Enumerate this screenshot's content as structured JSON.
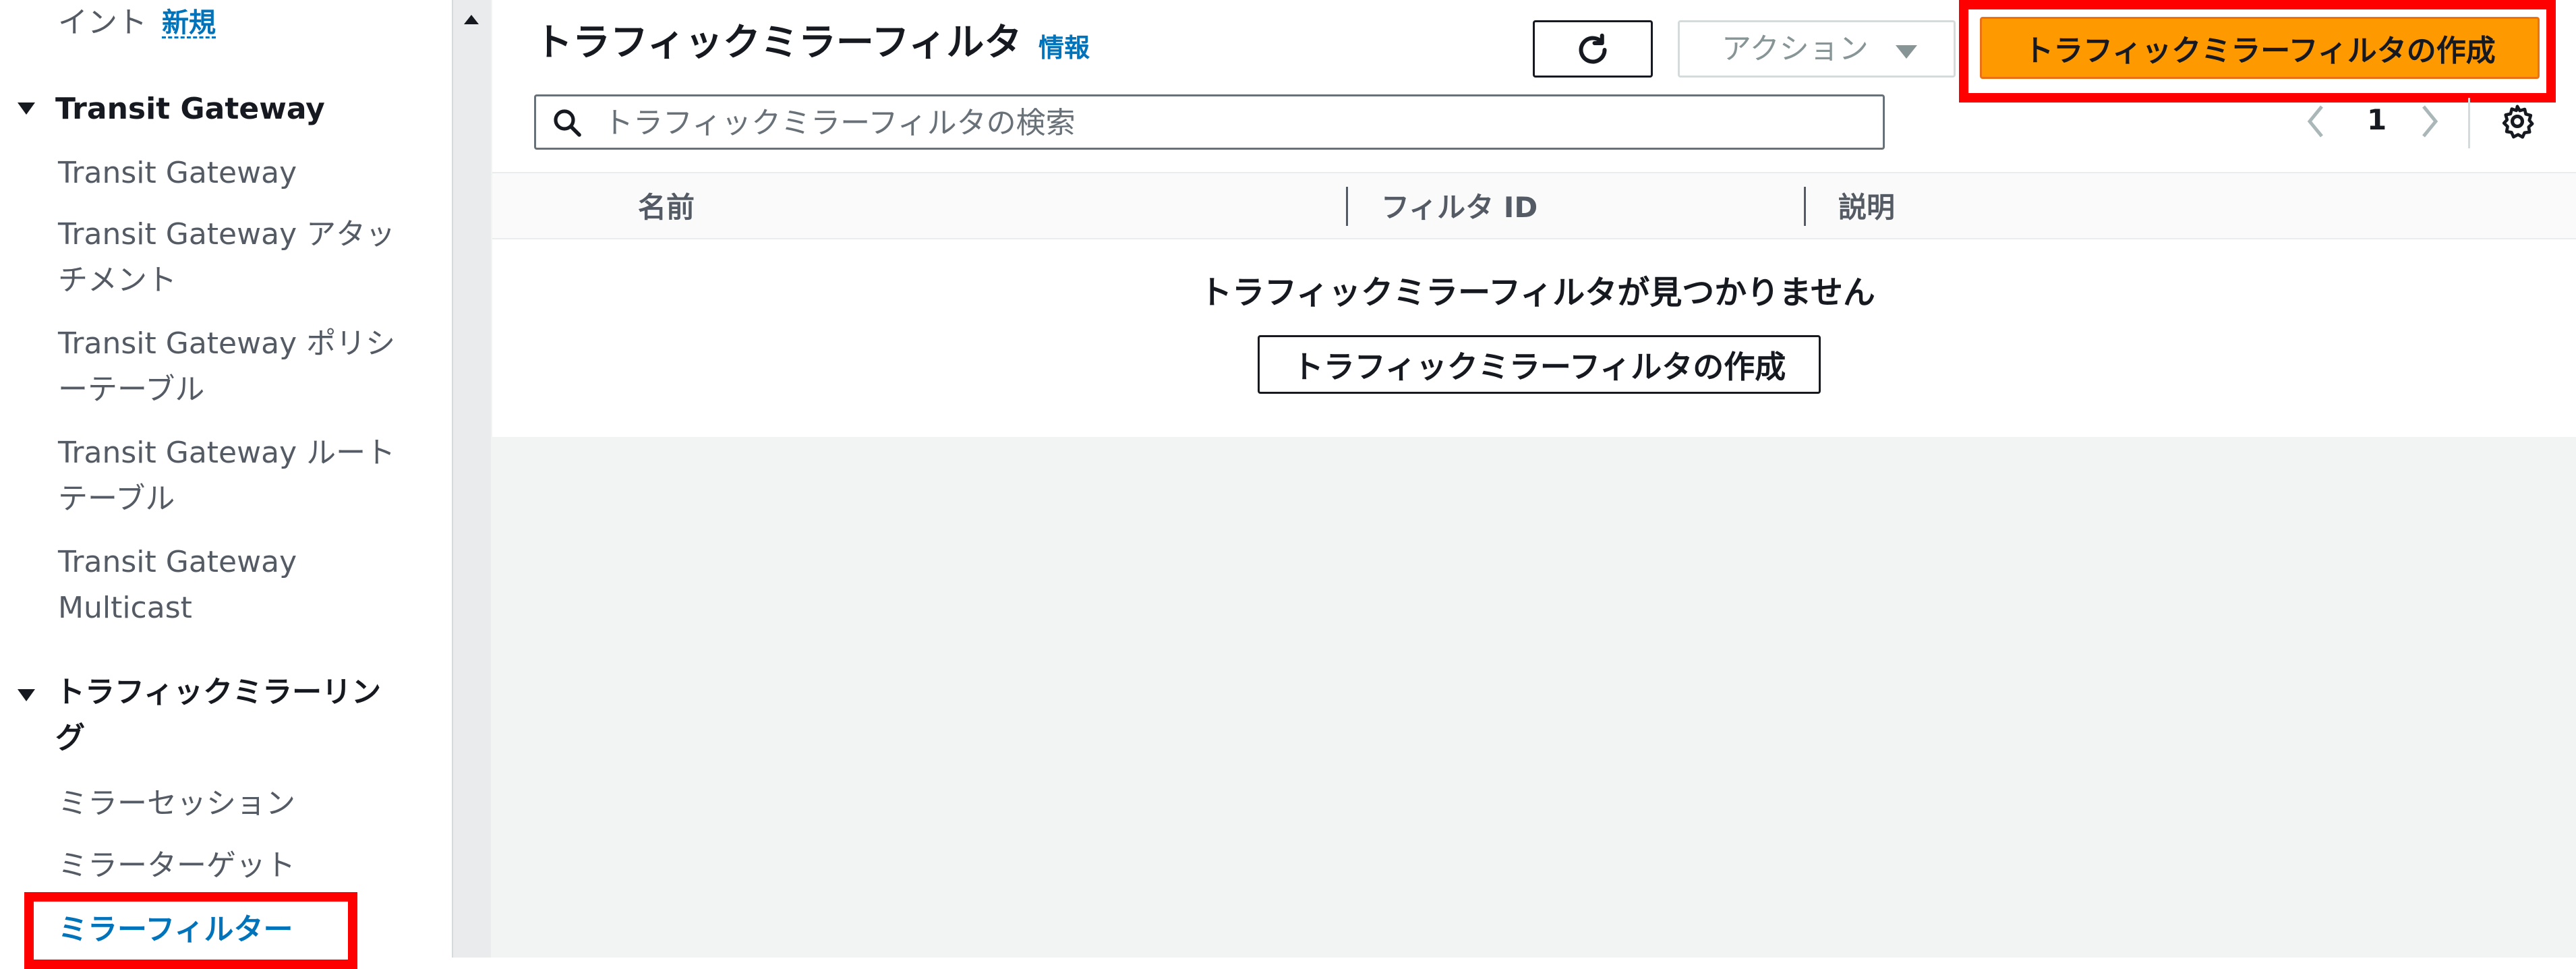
{
  "sidebar": {
    "top_item": {
      "label": "イント",
      "badge": "新規"
    },
    "transit_section": "Transit Gateway",
    "transit_items": [
      {
        "line1": "Transit Gateway"
      },
      {
        "line1": "Transit Gateway アタッ",
        "line2": "チメント"
      },
      {
        "line1": "Transit Gateway ポリシ",
        "line2": "ーテーブル"
      },
      {
        "line1": "Transit Gateway ルート",
        "line2": "テーブル"
      },
      {
        "line1": "Transit Gateway",
        "line2": "Multicast"
      }
    ],
    "mirror_section": {
      "line1": "トラフィックミラーリン",
      "line2": "グ"
    },
    "mirror_items": [
      "ミラーセッション",
      "ミラーターゲット"
    ],
    "active_item": "ミラーフィルター"
  },
  "header": {
    "title": "トラフィックミラーフィルタ",
    "info": "情報",
    "actions_label": "アクション",
    "create_label": "トラフィックミラーフィルタの作成"
  },
  "search": {
    "placeholder": "トラフィックミラーフィルタの検索"
  },
  "pagination": {
    "current_page": "1"
  },
  "table": {
    "columns": [
      "名前",
      "フィルタ ID",
      "説明"
    ],
    "empty_title": "トラフィックミラーフィルタが見つかりません",
    "empty_button": "トラフィックミラーフィルタの作成"
  },
  "colors": {
    "accent": "#0073bb",
    "primary": "#ff9900",
    "highlight": "#ff0000"
  }
}
